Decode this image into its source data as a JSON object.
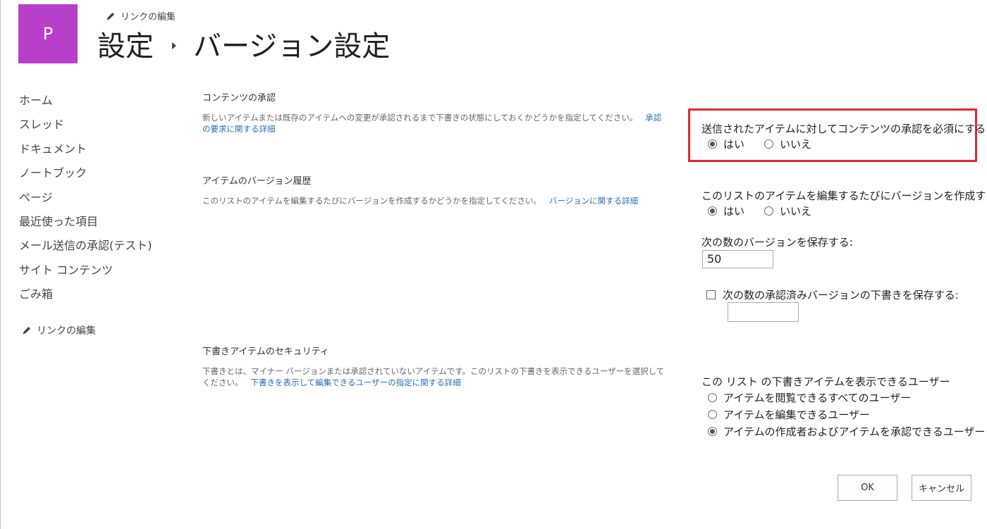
{
  "site": {
    "logo_letter": "P"
  },
  "header": {
    "edit_links_label": "リンクの編集",
    "title_parent": "設定",
    "title_current": "バージョン設定"
  },
  "nav": {
    "items": [
      "ホーム",
      "スレッド",
      "ドキュメント",
      "ノートブック",
      "ページ",
      "最近使った項目",
      "メール送信の承認(テスト)",
      "サイト コンテンツ",
      "ごみ箱"
    ],
    "edit_links_label": "リンクの編集"
  },
  "sections": {
    "content_approval": {
      "title": "コンテンツの承認",
      "description": "新しいアイテムまたは既存のアイテムへの変更が承認されるまで下書きの状態にしておくかどうかを指定してください。",
      "link": "承認の要求に関する詳細",
      "question": "送信されたアイテムに対してコンテンツの承認を必須にする",
      "yes": "はい",
      "no": "いいえ",
      "selected": "yes"
    },
    "version_history": {
      "title": "アイテムのバージョン履歴",
      "description": "このリストのアイテムを編集するたびにバージョンを作成するかどうかを指定してください。",
      "link": "バージョンに関する詳細",
      "question": "このリストのアイテムを編集するたびにバージョンを作成する",
      "yes": "はい",
      "no": "いいえ",
      "selected": "yes",
      "keep_versions_label": "次の数のバージョンを保存する:",
      "keep_versions_value": "50",
      "keep_drafts_label": "次の数の承認済みバージョンの下書きを保存する:",
      "keep_drafts_checked": false,
      "keep_drafts_value": ""
    },
    "draft_security": {
      "title": "下書きアイテムのセキュリティ",
      "description": "下書きとは、マイナー バージョンまたは承認されていないアイテムです。このリストの下書きを表示できるユーザーを選択してください。",
      "link": "下書きを表示して編集できるユーザーの指定に関する詳細",
      "question": "この リスト の下書きアイテムを表示できるユーザー",
      "options": [
        "アイテムを閲覧できるすべてのユーザー",
        "アイテムを編集できるユーザー",
        "アイテムの作成者およびアイテムを承認できるユーザー"
      ],
      "selected_index": 2
    }
  },
  "buttons": {
    "ok": "OK",
    "cancel": "キャンセル"
  },
  "colors": {
    "logo_bg": "#b83fc9",
    "link": "#2a6db8",
    "highlight": "#e3262e"
  }
}
